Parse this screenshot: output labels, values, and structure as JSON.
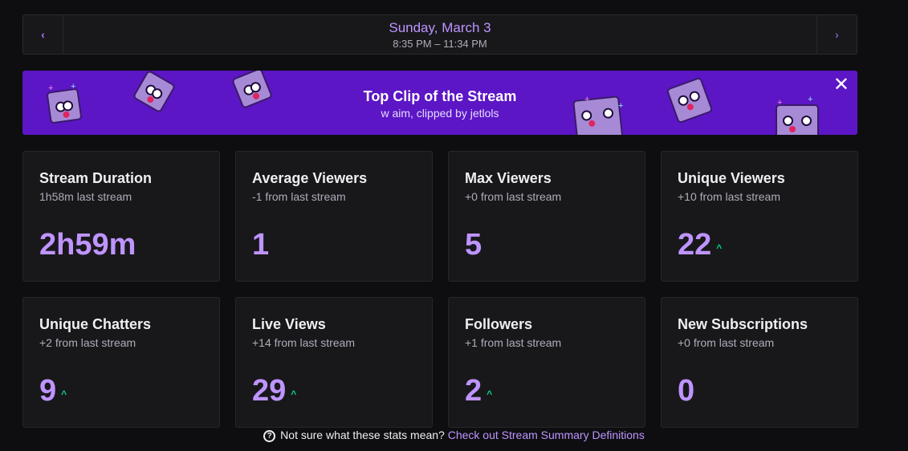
{
  "date_nav": {
    "prev_icon": "chevron-left-icon",
    "next_icon": "chevron-right-icon",
    "prev_glyph": "‹",
    "next_glyph": "›",
    "date": "Sunday, March 3",
    "time_range": "8:35 PM – 11:34 PM"
  },
  "banner": {
    "title": "Top Clip of the Stream",
    "subtitle": "w aim, clipped by jetlols",
    "close_glyph": "✕",
    "background": "#5c16c5"
  },
  "stats": [
    {
      "title": "Stream Duration",
      "sub": "1h58m last stream",
      "value": "2h59m",
      "trend_up": false
    },
    {
      "title": "Average Viewers",
      "sub": "-1 from last stream",
      "value": "1",
      "trend_up": false
    },
    {
      "title": "Max Viewers",
      "sub": "+0 from last stream",
      "value": "5",
      "trend_up": false
    },
    {
      "title": "Unique Viewers",
      "sub": "+10 from last stream",
      "value": "22",
      "trend_up": true
    },
    {
      "title": "Unique Chatters",
      "sub": "+2 from last stream",
      "value": "9",
      "trend_up": true
    },
    {
      "title": "Live Views",
      "sub": "+14 from last stream",
      "value": "29",
      "trend_up": true
    },
    {
      "title": "Followers",
      "sub": "+1 from last stream",
      "value": "2",
      "trend_up": true
    },
    {
      "title": "New Subscriptions",
      "sub": "+0 from last stream",
      "value": "0",
      "trend_up": false
    }
  ],
  "trend_glyph": "^",
  "footer": {
    "help_glyph": "?",
    "text": "Not sure what these stats mean?",
    "link": "Check out Stream Summary Definitions"
  },
  "colors": {
    "accent": "#bf94ff",
    "trend_up": "#00d68f",
    "card_bg": "#18181b",
    "page_bg": "#0e0e10"
  }
}
